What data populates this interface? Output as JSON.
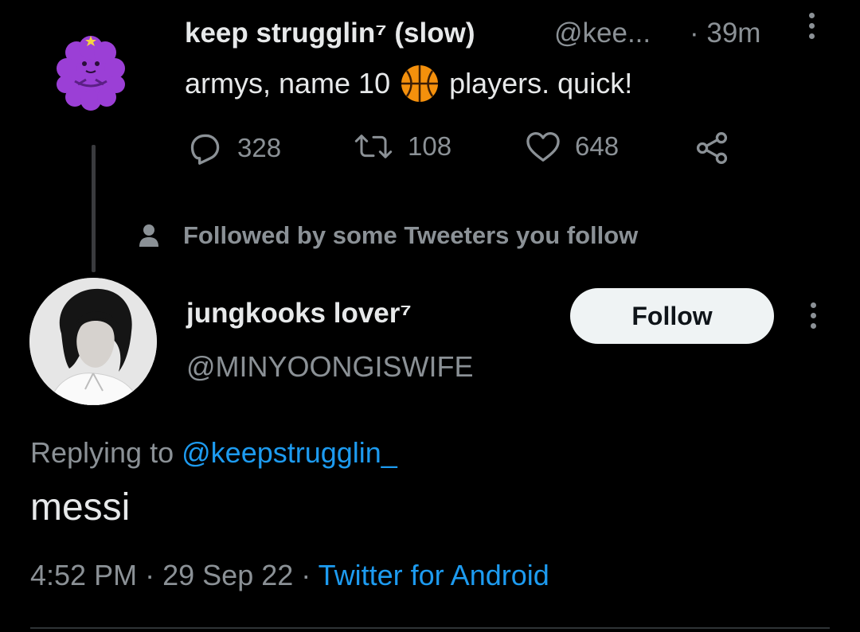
{
  "parent_tweet": {
    "display_name": "keep strugglin⁷ (slow)",
    "handle": "@kee...",
    "time": "· 39m",
    "text_before": "armys, name 10",
    "text_emoji": "basketball-emoji",
    "text_after": "players. quick!",
    "stats": {
      "replies": "328",
      "retweets": "108",
      "likes": "648"
    },
    "avatar_icon": "lumpy-space-princess-avatar",
    "avatar_color": "#9b3fd6"
  },
  "followed_notice": "Followed by some Tweeters you follow",
  "reply_tweet": {
    "display_name": "jungkooks lover⁷",
    "handle": "@MINYOONGISWIFE",
    "follow_label": "Follow",
    "replying_prefix": "Replying to",
    "replying_mention": "@keepstrugglin_",
    "text": "messi",
    "time": "4:52 PM",
    "separator": "·",
    "date": "29 Sep 22",
    "source": "Twitter for Android",
    "avatar_icon": "profile-photo-avatar"
  },
  "colors": {
    "background": "#000000",
    "primary_text": "#e7e9ea",
    "secondary_text": "#8b9196",
    "link": "#1d9bf0",
    "follow_button_bg": "#eff3f4"
  }
}
